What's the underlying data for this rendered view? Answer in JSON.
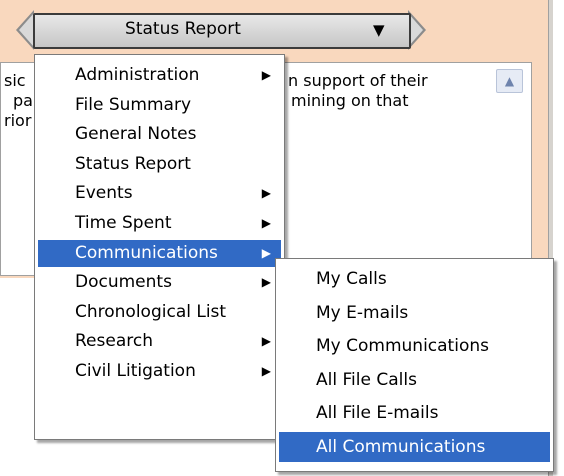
{
  "header": {
    "title": "Status Report",
    "dropdown_glyph": "▼"
  },
  "textarea": {
    "lines": [
      "sic",
      "pa",
      "rior",
      "n support of their",
      "mining on that"
    ],
    "scroll_up_glyph": "▲"
  },
  "menu": {
    "items": [
      {
        "label": "Administration",
        "has_submenu": true
      },
      {
        "label": "File Summary",
        "has_submenu": false
      },
      {
        "label": "General Notes",
        "has_submenu": false
      },
      {
        "label": "Status Report",
        "has_submenu": false
      },
      {
        "label": "Events",
        "has_submenu": true
      },
      {
        "label": "Time Spent",
        "has_submenu": true
      },
      {
        "label": "Communications",
        "has_submenu": true
      },
      {
        "label": "Documents",
        "has_submenu": true
      },
      {
        "label": "Chronological List",
        "has_submenu": false
      },
      {
        "label": "Research",
        "has_submenu": true
      },
      {
        "label": "Civil Litigation",
        "has_submenu": true
      }
    ],
    "submenu_glyph": "▶"
  },
  "submenu": {
    "items": [
      {
        "label": "My Calls"
      },
      {
        "label": "My E-mails"
      },
      {
        "label": "My Communications"
      },
      {
        "label": "All File Calls"
      },
      {
        "label": "All File E-mails"
      },
      {
        "label": "All Communications"
      }
    ]
  },
  "colors": {
    "highlight": "#316ac5",
    "background_band": "#f9d8be"
  }
}
